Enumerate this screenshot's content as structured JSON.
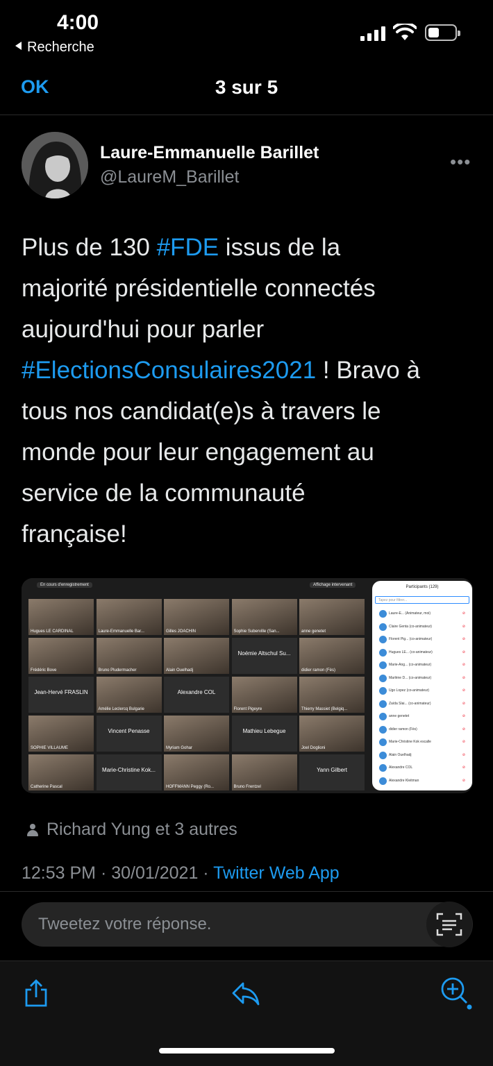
{
  "status_bar": {
    "time": "4:00",
    "back_app": "Recherche"
  },
  "nav": {
    "ok_label": "OK",
    "title": "3 sur 5"
  },
  "author": {
    "name": "Laure-Emmanuelle Barillet",
    "handle": "@LaureM_Barillet"
  },
  "tweet": {
    "lines": [
      [
        {
          "t": "Plus de 130 "
        },
        {
          "t": "#FDE",
          "tag": true
        },
        {
          "t": " issus de la"
        }
      ],
      [
        {
          "t": "majorité présidentielle connectés"
        }
      ],
      [
        {
          "t": "aujourd'hui pour parler"
        }
      ],
      [
        {
          "t": "#ElectionsConsulaires2021",
          "tag": true
        },
        {
          "t": " ! Bravo à"
        }
      ],
      [
        {
          "t": "tous nos candidat(e)s à travers le"
        }
      ],
      [
        {
          "t": "monde pour leur engagement au"
        }
      ],
      [
        {
          "t": "service de  la communauté"
        }
      ],
      [
        {
          "t": "française!"
        }
      ]
    ]
  },
  "media": {
    "recording_label": "En cours d'enregistrement",
    "view_label": "Affichage intervenant",
    "tiles": [
      [
        "Hugues LE CARDINAL",
        "Laure-Emmanuelle Bar...",
        "Gilles JOACHIN",
        "Sophie Suberville (San...",
        "anne genetet"
      ],
      [
        "Frédéric Bove",
        "Bruno Pludermacher",
        "Alain Ouelhadj",
        "Noémie Altschul Su...",
        "didier ramon (Fès)"
      ],
      [
        "Jean-Hervé FRASLIN",
        "Amélie Leclercq Bulgarie",
        "Alexandre COL",
        "Florent Pigeyre",
        "Thierry Massiet (Belgiq..."
      ],
      [
        "SOPHIE VILLAUME",
        "Vincent Penasse",
        "Myriam Gohar",
        "Mathieu Lebegue",
        "Joel Doglioni"
      ],
      [
        "Catherine Pascal",
        "Marie-Christine Kok...",
        "HOFFMANN Peggy (Ro...",
        "Bruno Frentzel",
        "Yann Gilbert"
      ]
    ],
    "name_only_tiles": [
      "Noémie Altschul Su...",
      "Jean-Hervé FRASLIN",
      "Alexandre COL",
      "Vincent Penasse",
      "Mathieu Lebegue",
      "Marie-Christine Kok...",
      "Yann Gilbert"
    ],
    "participants_title": "Participants (129)",
    "participants_search_placeholder": "Tapez pour filtrer...",
    "participants": [
      "Laure-E...  (Animateur, moi)",
      "Claire Genta  (co-animateur)",
      "Florent Pig...  (co-animateur)",
      "Hugues LE...  (co-animateur)",
      "Marie-Ang...  (co-animateur)",
      "Marlène D...  (co-animateur)",
      "Ugo Lopez  (co-animateur)",
      "Zaïda Slai...  (co-animateur)",
      "anne genetet",
      "didier ramon (Fès)",
      "Marie-Christine Kok escalle",
      "Alain Ouelhadj",
      "Alexandre COL",
      "Alexandre Kleitman"
    ]
  },
  "likes_text": "Richard Yung et 3 autres",
  "meta": {
    "time": "12:53 PM",
    "date": "30/01/2021",
    "source": "Twitter Web App",
    "sep": " · "
  },
  "reply": {
    "placeholder": "Tweetez votre réponse."
  },
  "colors": {
    "accent": "#1d9bf0",
    "background": "#000000",
    "secondary_text": "#8b8f94"
  },
  "icons": [
    "share-icon",
    "reply-icon",
    "compose-reply-icon",
    "text-scan-icon",
    "more-icon"
  ]
}
